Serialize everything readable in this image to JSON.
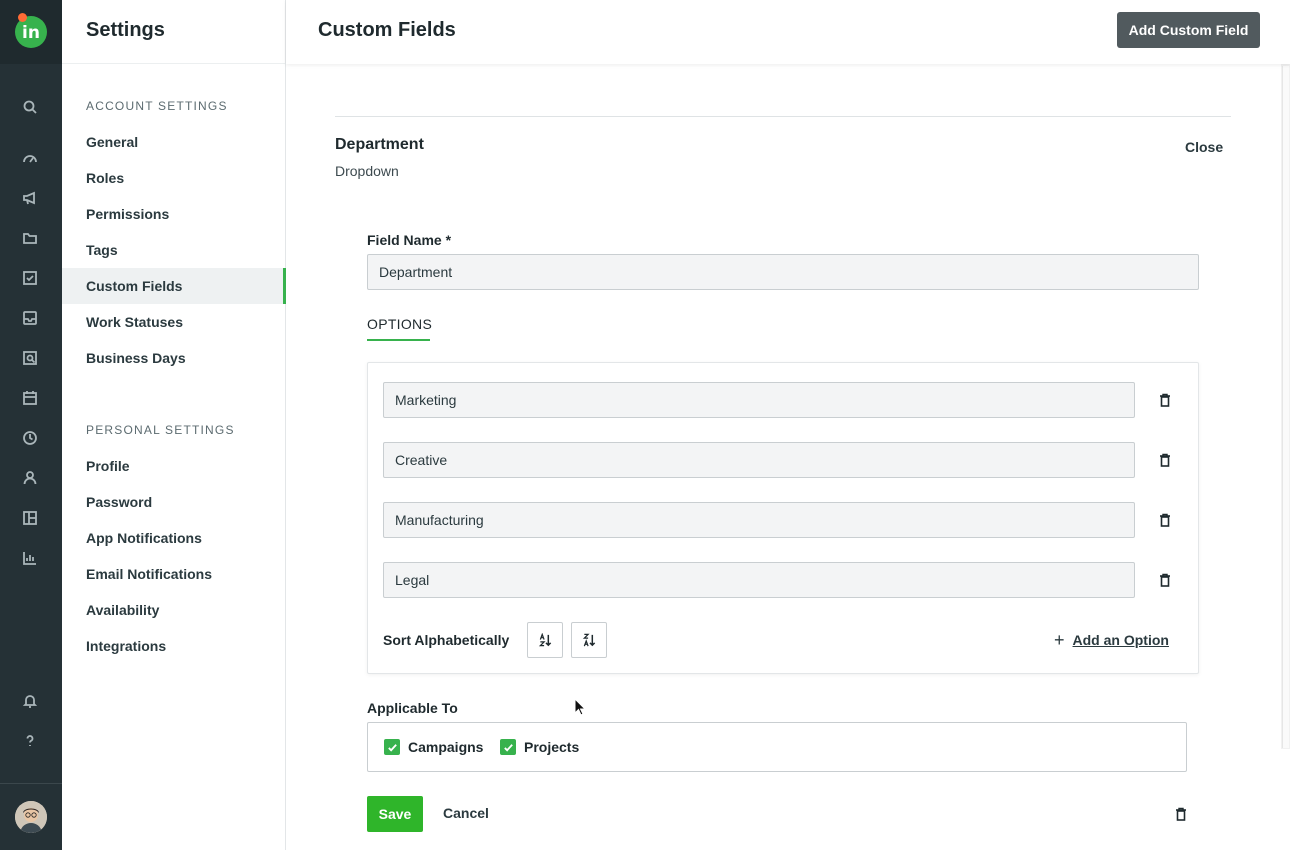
{
  "rail": {
    "logo_text": "in",
    "icons": [
      "search-icon",
      "dashboard-icon",
      "megaphone-icon",
      "folder-icon",
      "task-check-icon",
      "inbox-icon",
      "review-icon",
      "calendar-icon",
      "clock-icon",
      "user-icon",
      "layout-icon",
      "bar-chart-icon",
      "bell-icon",
      "help-icon"
    ]
  },
  "sidebar": {
    "title": "Settings",
    "account_label": "ACCOUNT SETTINGS",
    "account_items": [
      {
        "label": "General"
      },
      {
        "label": "Roles"
      },
      {
        "label": "Permissions"
      },
      {
        "label": "Tags"
      },
      {
        "label": "Custom Fields",
        "active": true
      },
      {
        "label": "Work Statuses"
      },
      {
        "label": "Business Days"
      }
    ],
    "personal_label": "PERSONAL SETTINGS",
    "personal_items": [
      {
        "label": "Profile"
      },
      {
        "label": "Password"
      },
      {
        "label": "App Notifications"
      },
      {
        "label": "Email Notifications"
      },
      {
        "label": "Availability"
      },
      {
        "label": "Integrations"
      }
    ]
  },
  "header": {
    "title": "Custom Fields",
    "add_button": "Add Custom Field"
  },
  "field": {
    "name": "Department",
    "type": "Dropdown",
    "close_label": "Close",
    "name_label": "Field Name *",
    "name_value": "Department",
    "options_tab": "OPTIONS",
    "options": [
      "Marketing",
      "Creative",
      "Manufacturing",
      "Legal"
    ],
    "sort_label": "Sort Alphabetically",
    "add_option_label": "Add an Option",
    "applicable_label": "Applicable To",
    "applicable": [
      {
        "label": "Campaigns",
        "checked": true
      },
      {
        "label": "Projects",
        "checked": true
      }
    ],
    "save_label": "Save",
    "cancel_label": "Cancel"
  },
  "colors": {
    "accent_green": "#37b24d",
    "rail_bg": "#253136",
    "add_button_bg": "#515a5e"
  }
}
